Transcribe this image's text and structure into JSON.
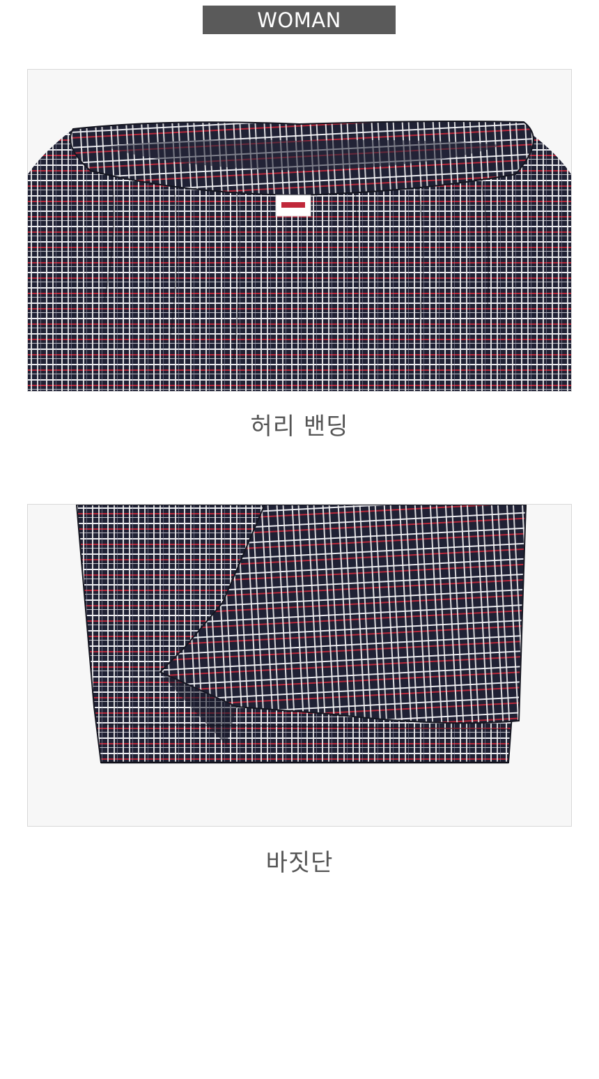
{
  "banner": {
    "label": "WOMAN"
  },
  "details": [
    {
      "caption": "허리 밴딩",
      "photo_subject": "plaid-waistband"
    },
    {
      "caption": "바짓단",
      "photo_subject": "plaid-pant-hem"
    }
  ],
  "colors": {
    "banner_bg": "#5a5a5a",
    "fabric_navy": "#1f2134",
    "fabric_red": "#b8283a",
    "fabric_white": "#f2f2f2",
    "caption_text": "#555555"
  }
}
